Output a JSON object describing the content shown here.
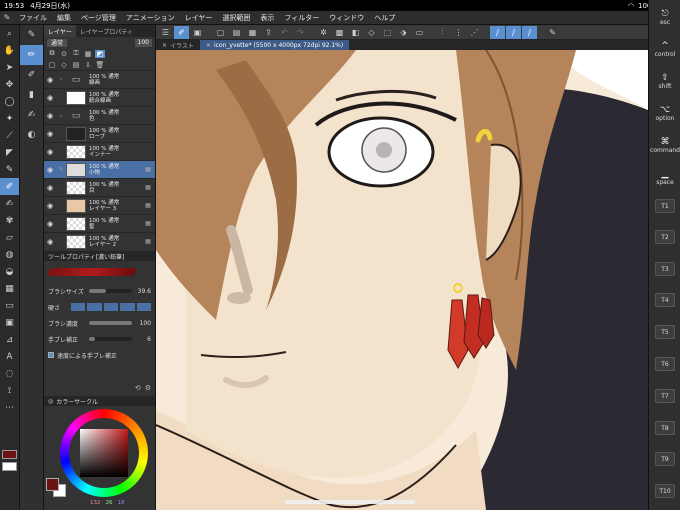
{
  "statusbar": {
    "time": "19:53",
    "date": "4月29日(水)",
    "battery": "100%"
  },
  "menu": {
    "items": [
      "ファイル",
      "編集",
      "ページ管理",
      "アニメーション",
      "レイヤー",
      "選択範囲",
      "表示",
      "フィルター",
      "ウィンドウ",
      "ヘルプ"
    ]
  },
  "tabs": [
    {
      "label": "イラスト"
    },
    {
      "label": "icon_yvette* (5500 x 4000px 72dpi 92.1%)"
    }
  ],
  "layer_panel": {
    "tabs": [
      "レイヤー",
      "レイヤープロパティ"
    ],
    "blend_mode": "通常",
    "opacity": "100",
    "layers": [
      {
        "line1": "100 % 通常",
        "line2": "線画",
        "folder": true
      },
      {
        "line1": "100 % 通常",
        "line2": "統合線画"
      },
      {
        "line1": "100 % 通常",
        "line2": "色",
        "folder": true
      },
      {
        "line1": "100 % 通常",
        "line2": "ローブ"
      },
      {
        "line1": "100 % 通常",
        "line2": "インナー"
      },
      {
        "line1": "100 % 通常",
        "line2": "小物"
      },
      {
        "line1": "100 % 通常",
        "line2": "目"
      },
      {
        "line1": "100 % 通常",
        "line2": "レイヤー 3"
      },
      {
        "line1": "100 % 通常",
        "line2": "髪"
      },
      {
        "line1": "100 % 通常",
        "line2": "レイヤー 2"
      }
    ]
  },
  "tool_property": {
    "title": "ツールプロパティ[濃い鉛筆]",
    "brush_name": "濃い鉛筆",
    "brush_size_label": "ブラシサイズ",
    "brush_size": "39.6",
    "brush_size_fraction": 0.4,
    "hardness_label": "硬さ",
    "density_label": "ブラシ濃度",
    "density": "100",
    "density_fraction": 1.0,
    "stabilization_label": "手ブレ補正",
    "stabilization": "6",
    "stabilization_fraction": 0.15,
    "speed_stab_label": "速度による手ブレ補正"
  },
  "color_panel": {
    "title": "カラーサークル",
    "h": "132",
    "s": "26",
    "v": "18"
  },
  "keys": {
    "esc": "esc",
    "control": "control",
    "shift": "shift",
    "option": "option",
    "command": "command",
    "space": "space",
    "t_keys": [
      "T1",
      "T2",
      "T3",
      "T4",
      "T5",
      "T6",
      "T7",
      "T8",
      "T9",
      "T10"
    ]
  },
  "colors": {
    "main": "#6b1414",
    "sub": "#ffffff",
    "accent": "#5a8fd0"
  }
}
